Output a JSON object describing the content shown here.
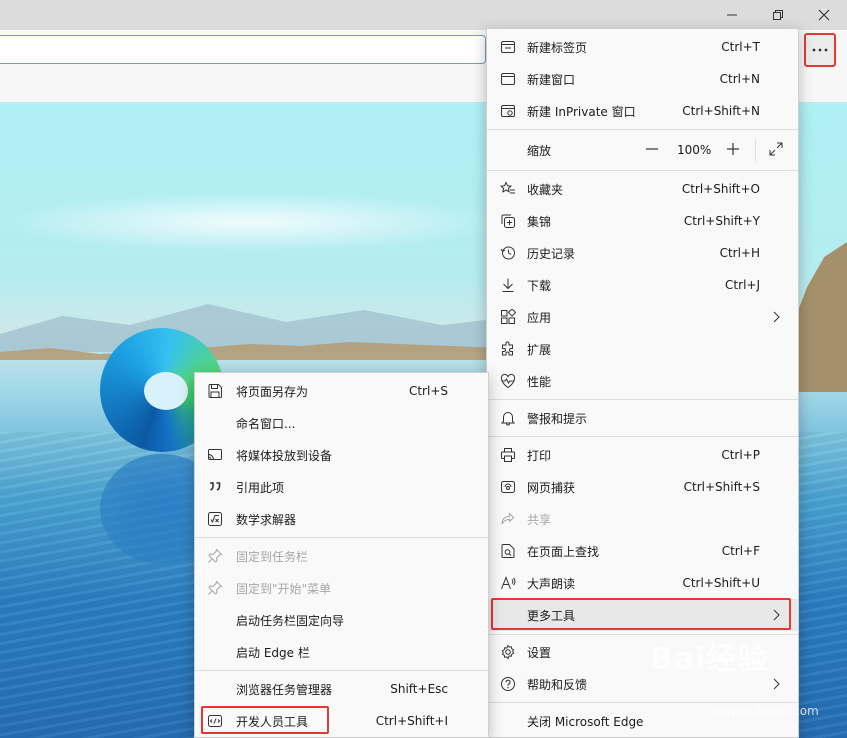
{
  "window": {
    "controls": [
      "minimize-icon",
      "restore-icon",
      "close-icon"
    ]
  },
  "main_menu": {
    "items": [
      {
        "label": "新建标签页",
        "shortcut": "Ctrl+T",
        "icon": "new-tab-icon"
      },
      {
        "label": "新建窗口",
        "shortcut": "Ctrl+N",
        "icon": "new-window-icon"
      },
      {
        "label": "新建 InPrivate 窗口",
        "shortcut": "Ctrl+Shift+N",
        "icon": "inprivate-icon"
      },
      {
        "label": "缩放",
        "shortcut": "",
        "icon": ""
      },
      {
        "label": "收藏夹",
        "shortcut": "Ctrl+Shift+O",
        "icon": "favorites-icon"
      },
      {
        "label": "集锦",
        "shortcut": "Ctrl+Shift+Y",
        "icon": "collections-icon"
      },
      {
        "label": "历史记录",
        "shortcut": "Ctrl+H",
        "icon": "history-icon"
      },
      {
        "label": "下载",
        "shortcut": "Ctrl+J",
        "icon": "download-icon"
      },
      {
        "label": "应用",
        "shortcut": "",
        "icon": "apps-icon"
      },
      {
        "label": "扩展",
        "shortcut": "",
        "icon": "extensions-icon"
      },
      {
        "label": "性能",
        "shortcut": "",
        "icon": "performance-icon"
      },
      {
        "label": "警报和提示",
        "shortcut": "",
        "icon": "bell-icon"
      },
      {
        "label": "打印",
        "shortcut": "Ctrl+P",
        "icon": "printer-icon"
      },
      {
        "label": "网页捕获",
        "shortcut": "Ctrl+Shift+S",
        "icon": "web-capture-icon"
      },
      {
        "label": "共享",
        "shortcut": "",
        "icon": "share-icon"
      },
      {
        "label": "在页面上查找",
        "shortcut": "Ctrl+F",
        "icon": "find-icon"
      },
      {
        "label": "大声朗读",
        "shortcut": "Ctrl+Shift+U",
        "icon": "read-aloud-icon"
      },
      {
        "label": "更多工具",
        "shortcut": "",
        "icon": ""
      },
      {
        "label": "设置",
        "shortcut": "",
        "icon": "gear-icon"
      },
      {
        "label": "帮助和反馈",
        "shortcut": "",
        "icon": "help-icon"
      },
      {
        "label": "关闭 Microsoft Edge",
        "shortcut": "",
        "icon": ""
      }
    ],
    "zoom_value": "100%",
    "zoom_minus": "—",
    "zoom_plus": "+"
  },
  "sub_menu": {
    "items": [
      {
        "label": "将页面另存为",
        "shortcut": "Ctrl+S",
        "icon": "save-icon"
      },
      {
        "label": "命名窗口...",
        "shortcut": "",
        "icon": ""
      },
      {
        "label": "将媒体投放到设备",
        "shortcut": "",
        "icon": "cast-icon"
      },
      {
        "label": "引用此项",
        "shortcut": "",
        "icon": "quote-icon"
      },
      {
        "label": "数学求解器",
        "shortcut": "",
        "icon": "math-solver-icon"
      },
      {
        "label": "固定到任务栏",
        "shortcut": "",
        "icon": "pin-icon"
      },
      {
        "label": "固定到\"开始\"菜单",
        "shortcut": "",
        "icon": "pin-icon"
      },
      {
        "label": "启动任务栏固定向导",
        "shortcut": "",
        "icon": ""
      },
      {
        "label": "启动 Edge 栏",
        "shortcut": "",
        "icon": ""
      },
      {
        "label": "浏览器任务管理器",
        "shortcut": "Shift+Esc",
        "icon": ""
      },
      {
        "label": "开发人员工具",
        "shortcut": "Ctrl+Shift+I",
        "icon": "devtools-icon"
      }
    ]
  },
  "watermark": {
    "brand": "Bai经验",
    "url": "jingyan.baidu.com"
  },
  "colors": {
    "highlight_border": "#e53935",
    "menu_bg": "#f9f9f9",
    "hover_bg": "#e8e8e8"
  }
}
